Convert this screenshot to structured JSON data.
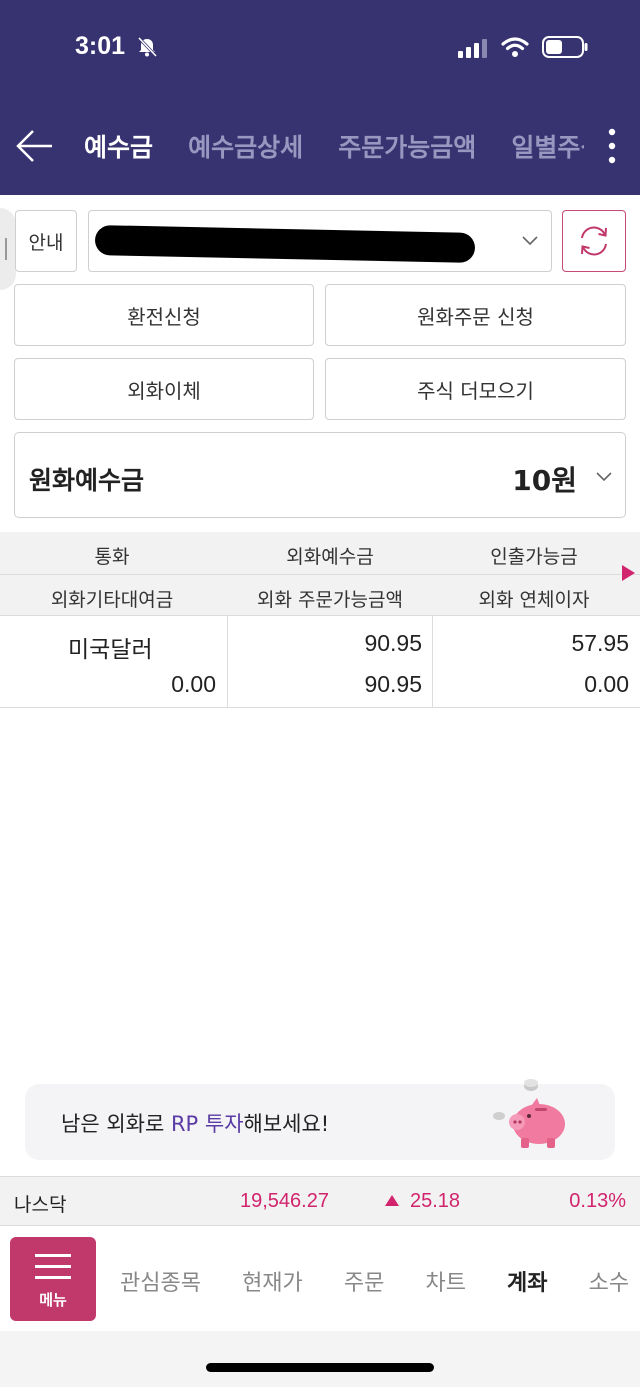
{
  "status": {
    "time": "3:01"
  },
  "header": {
    "tabs": [
      {
        "label": "예수금",
        "active": true
      },
      {
        "label": "예수금상세",
        "active": false
      },
      {
        "label": "주문가능금액",
        "active": false
      },
      {
        "label": "일별주식",
        "active": false
      }
    ]
  },
  "controls": {
    "guide_label": "안내",
    "buttons": [
      "환전신청",
      "원화주문 신청",
      "외화이체",
      "주식 더모으기"
    ]
  },
  "deposit": {
    "label": "원화예수금",
    "value": "10원"
  },
  "table": {
    "header_row1": [
      "통화",
      "외화예수금",
      "인출가능금"
    ],
    "header_row2": [
      "외화기타대여금",
      "외화 주문가능금액",
      "외화 연체이자"
    ],
    "rows": [
      {
        "currency": "미국달러",
        "fx_deposit": "90.95",
        "withdrawable": "57.95",
        "fx_other_loan": "0.00",
        "fx_orderable": "90.95",
        "fx_overdue_interest": "0.00"
      }
    ]
  },
  "banner": {
    "text_before": "남은 외화로 ",
    "text_highlight": "RP 투자",
    "text_after": "해보세요!"
  },
  "index": {
    "name": "나스닥",
    "price": "19,546.27",
    "change": "25.18",
    "percent": "0.13%",
    "direction": "up"
  },
  "bottom_nav": {
    "menu_label": "메뉴",
    "items": [
      {
        "label": "관심종목",
        "active": false
      },
      {
        "label": "현재가",
        "active": false
      },
      {
        "label": "주문",
        "active": false
      },
      {
        "label": "차트",
        "active": false
      },
      {
        "label": "계좌",
        "active": true
      },
      {
        "label": "소수",
        "active": false
      }
    ]
  },
  "colors": {
    "header_bg": "#373371",
    "accent": "#c0396a",
    "up_red": "#d2246e"
  }
}
